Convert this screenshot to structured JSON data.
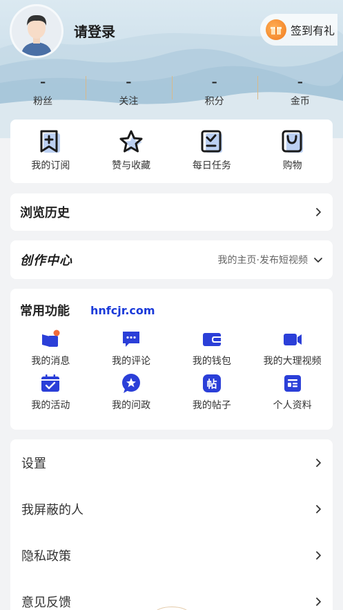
{
  "profile": {
    "login_text": "请登录",
    "sign_in_label": "签到有礼"
  },
  "stats": [
    {
      "value": "–",
      "label": "粉丝"
    },
    {
      "value": "–",
      "label": "关注"
    },
    {
      "value": "–",
      "label": "积分"
    },
    {
      "value": "–",
      "label": "金币"
    }
  ],
  "quick_actions": [
    {
      "label": "我的订阅",
      "icon": "bookmark-plus-icon"
    },
    {
      "label": "赞与收藏",
      "icon": "star-icon"
    },
    {
      "label": "每日任务",
      "icon": "task-icon"
    },
    {
      "label": "购物",
      "icon": "shopping-bag-icon"
    }
  ],
  "history": {
    "title": "浏览历史"
  },
  "creation": {
    "logo_text": "创作中心",
    "links": "我的主页·发布短视频"
  },
  "functions": {
    "title": "常用功能",
    "watermark": "hnfcjr.com",
    "items": [
      {
        "label": "我的消息",
        "icon": "message-icon"
      },
      {
        "label": "我的评论",
        "icon": "comment-icon"
      },
      {
        "label": "我的钱包",
        "icon": "wallet-icon"
      },
      {
        "label": "我的大理视频",
        "icon": "video-camera-icon"
      },
      {
        "label": "我的活动",
        "icon": "calendar-check-icon"
      },
      {
        "label": "我的问政",
        "icon": "star-bubble-icon"
      },
      {
        "label": "我的帖子",
        "icon": "post-icon"
      },
      {
        "label": "个人资料",
        "icon": "profile-card-icon"
      }
    ]
  },
  "settings": [
    {
      "label": "设置"
    },
    {
      "label": "我屏蔽的人"
    },
    {
      "label": "隐私政策"
    },
    {
      "label": "意见反馈"
    }
  ],
  "colors": {
    "accent_blue": "#2b3fd8",
    "gold_divider": "#d8b98a",
    "badge_orange": "#f06a3a"
  }
}
